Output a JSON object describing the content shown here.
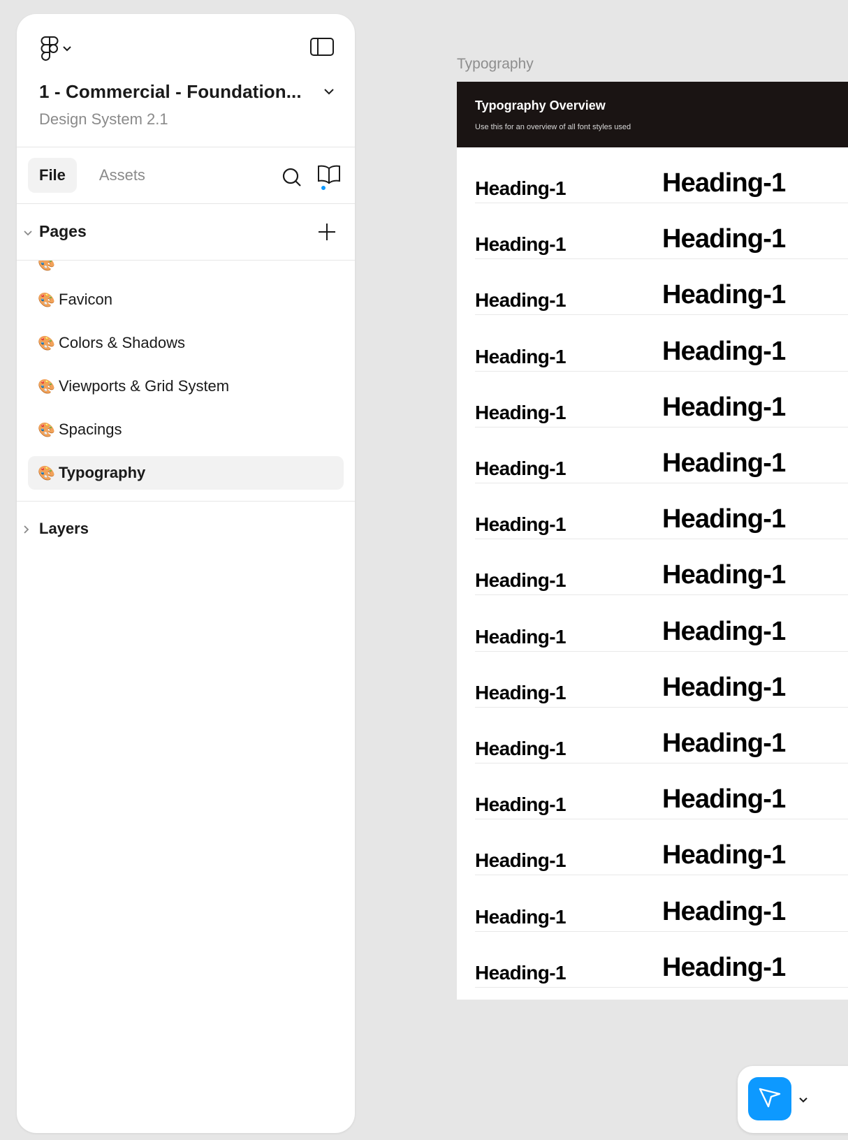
{
  "app": {
    "file_title": "1 - Commercial - Foundation...",
    "file_subtitle": "Design System 2.1"
  },
  "tabs": {
    "file": "File",
    "assets": "Assets"
  },
  "pages": {
    "header": "Pages",
    "items": [
      {
        "emoji": "🎨",
        "label": "Favicon"
      },
      {
        "emoji": "🎨",
        "label": "Colors & Shadows"
      },
      {
        "emoji": "🎨",
        "label": "Viewports & Grid System"
      },
      {
        "emoji": "🎨",
        "label": "Spacings"
      },
      {
        "emoji": "🎨",
        "label": "Typography",
        "active": true
      }
    ]
  },
  "layers": {
    "header": "Layers"
  },
  "canvas": {
    "frame_label": "Typography",
    "frame_title": "Typography Overview",
    "frame_description": "Use this for an overview of all font styles used",
    "rows": [
      {
        "small": "Heading-1",
        "large": "Heading-1"
      },
      {
        "small": "Heading-1",
        "large": "Heading-1"
      },
      {
        "small": "Heading-1",
        "large": "Heading-1"
      },
      {
        "small": "Heading-1",
        "large": "Heading-1"
      },
      {
        "small": "Heading-1",
        "large": "Heading-1"
      },
      {
        "small": "Heading-1",
        "large": "Heading-1"
      },
      {
        "small": "Heading-1",
        "large": "Heading-1"
      },
      {
        "small": "Heading-1",
        "large": "Heading-1"
      },
      {
        "small": "Heading-1",
        "large": "Heading-1"
      },
      {
        "small": "Heading-1",
        "large": "Heading-1"
      },
      {
        "small": "Heading-1",
        "large": "Heading-1"
      },
      {
        "small": "Heading-1",
        "large": "Heading-1"
      },
      {
        "small": "Heading-1",
        "large": "Heading-1"
      },
      {
        "small": "Heading-1",
        "large": "Heading-1"
      },
      {
        "small": "Heading-1",
        "large": "Heading-1"
      }
    ]
  },
  "icons": {
    "figma_menu": "figma-logo-icon",
    "sidebar_toggle": "sidebar-toggle-icon",
    "search": "search-icon",
    "library": "library-book-icon",
    "add_page": "plus-icon",
    "move_tool": "cursor-arrow-icon"
  },
  "colors": {
    "accent": "#0d99ff",
    "frame_header_bg": "#1a1413",
    "canvas_bg": "#e6e6e6"
  }
}
